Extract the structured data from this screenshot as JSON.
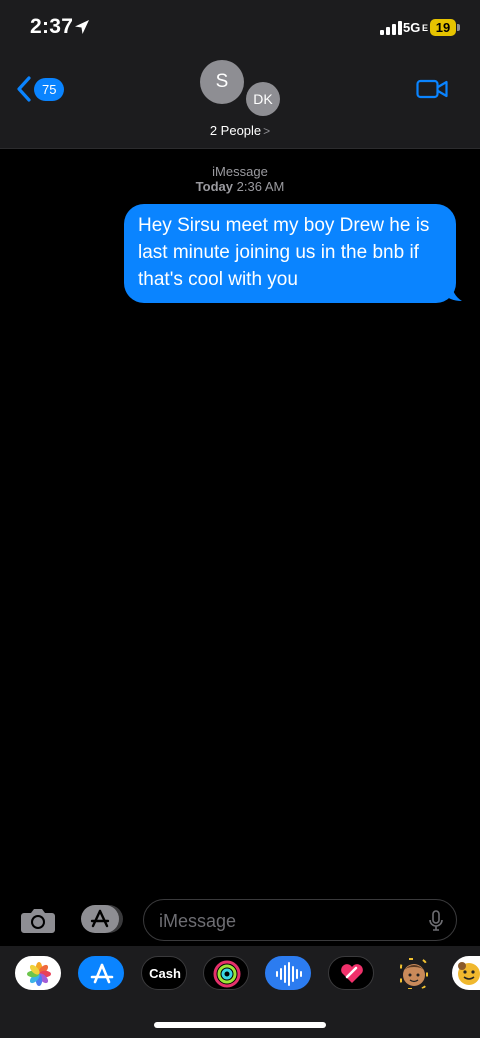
{
  "status": {
    "time": "2:37",
    "network": "5G",
    "network_suffix": "E",
    "battery": "19"
  },
  "header": {
    "back_count": "75",
    "avatars": [
      "S",
      "DK"
    ],
    "group_label": "2 People",
    "people_chevron": ">"
  },
  "conversation": {
    "service": "iMessage",
    "day": "Today",
    "time": "2:36 AM",
    "messages": [
      {
        "direction": "outgoing",
        "text": "Hey Sirsu meet my boy Drew he is last minute joining us in the bnb if that's cool with you"
      }
    ]
  },
  "compose": {
    "placeholder": "iMessage"
  },
  "drawer": {
    "apps": [
      {
        "name": "photos-icon"
      },
      {
        "name": "app-store-icon"
      },
      {
        "name": "apple-cash-icon",
        "label": "Cash"
      },
      {
        "name": "activity-icon"
      },
      {
        "name": "audio-message-icon"
      },
      {
        "name": "digital-touch-icon"
      },
      {
        "name": "memoji-icon"
      },
      {
        "name": "stickers-icon"
      }
    ]
  },
  "colors": {
    "accent": "#0a84ff",
    "background": "#000000",
    "bar": "#1c1c1e",
    "battery": "#e6c300"
  }
}
